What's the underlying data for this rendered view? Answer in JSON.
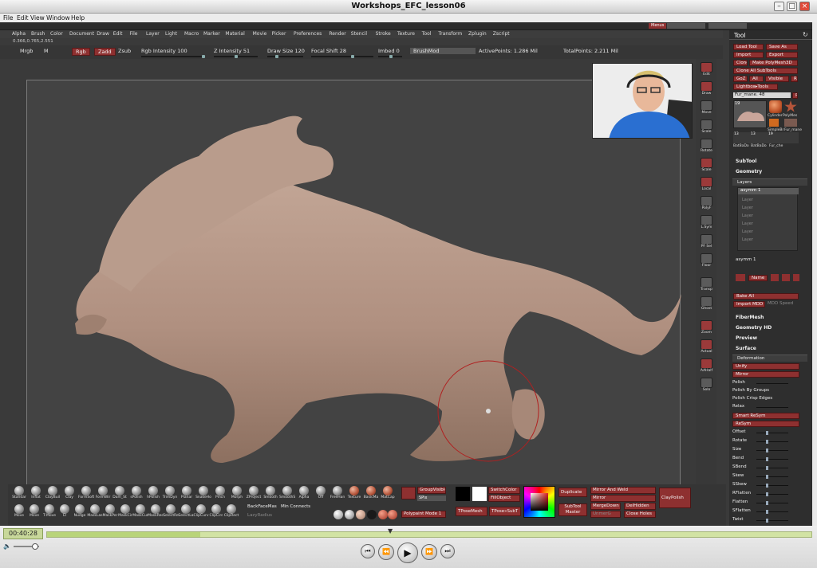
{
  "window": {
    "title": "Workshops_EFC_lesson06"
  },
  "menubar": [
    "File",
    "Edit",
    "View",
    "Window",
    "Help"
  ],
  "zbrush": {
    "top_right_label": "Menus",
    "menus": [
      "Alpha",
      "Brush",
      "Color",
      "Document",
      "Draw",
      "Edit",
      "File",
      "Layer",
      "Light",
      "Macro",
      "Marker",
      "Material",
      "Movie",
      "Picker",
      "Preferences",
      "Render",
      "Stencil",
      "Stroke",
      "Texture",
      "Tool",
      "Transform",
      "Zplugin",
      "Zscript"
    ],
    "coords": "0.366,0.765,2.551",
    "status": {
      "mrgb": "Mrgb",
      "m": "M",
      "rgb": "Rgb",
      "zadd": "Zadd",
      "zsub": "Zsub",
      "rgb_intensity": "Rgb Intensity 100",
      "z_intensity": "Z Intensity 51",
      "draw_size": "Draw Size 120",
      "focal_shift": "Focal Shift 28",
      "imbed": "Imbed 0",
      "brushmod": "BrushMod",
      "active_points": "ActivePoints: 1.286 Mil",
      "total_points": "TotalPoints: 2.211 Mil"
    },
    "right_strip": [
      "Edit",
      "Draw",
      "Move",
      "Scale",
      "Rotate",
      "Scale",
      "Local",
      "PolyF",
      "L.Sym",
      "PF Sel",
      "Floor",
      "Transp",
      "Ghost",
      "Zoom",
      "Actual",
      "AAHalf",
      "Solo"
    ],
    "tool_panel": {
      "header": "Tool",
      "buttons": [
        "Load Tool",
        "Save As",
        "Import",
        "Export",
        "Clone",
        "Make PolyMesh3D",
        "Clone All SubTools",
        "GoZ",
        "All",
        "Visible",
        "R",
        "Lightbox▸Tools"
      ],
      "tool_name": "Fur_mane. 48",
      "tool_count": "19",
      "thumbs": [
        "Cylinder",
        "PolyMes",
        "SimpleBr",
        "Fur_mane",
        "BatBaDo",
        "BatBaDo",
        "Fur_che"
      ],
      "thumb_nums": [
        "19",
        "19",
        "13",
        "13",
        "19"
      ],
      "sections": [
        "SubTool",
        "Geometry",
        "Layers",
        "FiberMesh",
        "Geometry HD",
        "Preview",
        "Surface",
        "Deformation"
      ],
      "layer_label": "asymm 1",
      "layers": [
        "Layer",
        "Layer",
        "Layer",
        "Layer",
        "Layer",
        "Layer",
        "Layer"
      ],
      "layer_footer": "asymm 1",
      "layer_name_btn": "Name",
      "bake_all": "Bake All",
      "import_mdd": "Import MDD",
      "mdd_speed": "MDD Speed",
      "deformation": [
        "Unify",
        "Mirror",
        "Polish",
        "Polish By Groups",
        "Polish Crisp Edges",
        "Relax",
        "Smart ReSym",
        "ReSym",
        "Offset",
        "Rotate",
        "Size",
        "Bend",
        "SBend",
        "Skew",
        "SSkew",
        "RFlatten",
        "Flatten",
        "SFlatten",
        "Twist"
      ]
    },
    "brushes_row1": [
      "Standar",
      "Inflat",
      "ClayBuil",
      "Clay",
      "FormSoft",
      "FormWir",
      "Dam_St",
      "sPolish",
      "hPolish",
      "TrimDyn",
      "Planar",
      "SnakeHo",
      "Pinch",
      "Morph",
      "ZProject",
      "Smooth",
      "SmoothS",
      "Alpha",
      "Off",
      "FreeHan",
      "Texture",
      "BasicMa",
      "MatCap"
    ],
    "brushes_row2": [
      "Move",
      "Move",
      "T-Move",
      "El",
      "Nudge",
      "MaskLas",
      "MaskPer",
      "MaskCir",
      "MaskCur",
      "MaskRec",
      "SelectRe",
      "SelectLa",
      "ClipCurv",
      "ClipCirc",
      "ClipRect"
    ],
    "mats": [
      "Flat",
      "Cok",
      "SkinShac",
      "Chr",
      "RS_Red",
      "RS_CWC"
    ],
    "bottom_labels": {
      "backface": "BackFaceMas",
      "min_connects": "Min Connects",
      "lazy": "LazyRadius",
      "group_visible": "GroupVisible",
      "polypaint": "Polypaint Mode 1",
      "spix": "SPix",
      "switchcolor": "SwitchColor",
      "fillobject": "FillObject",
      "tposemesh": "TPoseMesh",
      "tposesubt": "TPose»SubT",
      "duplicate": "Duplicate",
      "subtool_master": "SubTool Master",
      "mirror_weld": "Mirror And Weld",
      "mirror": "Mirror",
      "merge_down": "MergeDown",
      "del_hidden": "DelHidden",
      "close_holes": "Close Holes",
      "unmerge": "UnmerG",
      "clay_polish": "ClayPolish"
    }
  },
  "player": {
    "time": "00:40:28",
    "progress": 0.2
  }
}
